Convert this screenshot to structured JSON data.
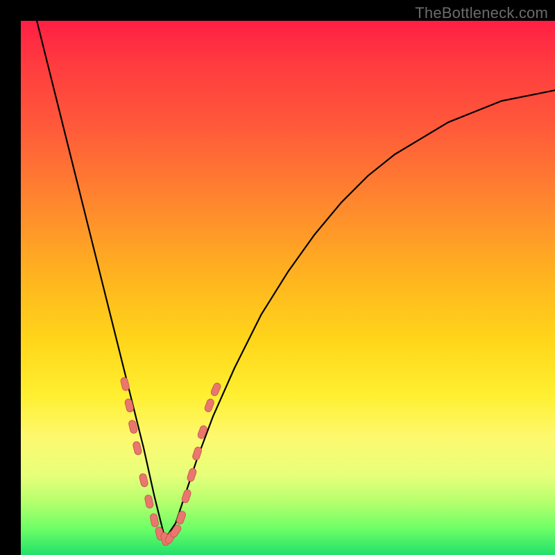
{
  "watermark": {
    "text": "TheBottleneck.com"
  },
  "colors": {
    "frame": "#000000",
    "curve_stroke": "#000000",
    "marker_fill": "#e9776e",
    "marker_stroke": "#c95a52"
  },
  "chart_data": {
    "type": "line",
    "title": "",
    "xlabel": "",
    "ylabel": "",
    "xlim": [
      0,
      100
    ],
    "ylim": [
      0,
      100
    ],
    "grid": false,
    "legend": false,
    "annotations": [],
    "series": [
      {
        "name": "curve",
        "comment": "V-shaped bottleneck curve; values estimated from pixel positions. y is percentage height from bottom (0) to top (100). Minimum near x≈27.",
        "x": [
          3,
          5,
          7,
          9,
          11,
          13,
          15,
          17,
          19,
          21,
          23,
          25,
          27,
          29,
          31,
          33,
          36,
          40,
          45,
          50,
          55,
          60,
          65,
          70,
          75,
          80,
          85,
          90,
          95,
          100
        ],
        "y": [
          100,
          92,
          84,
          76,
          68,
          60,
          52,
          44,
          36,
          28,
          20,
          11,
          3,
          6,
          12,
          18,
          26,
          35,
          45,
          53,
          60,
          66,
          71,
          75,
          78,
          81,
          83,
          85,
          86,
          87
        ]
      }
    ],
    "markers": {
      "comment": "Salmon capsule markers clustered on both arms of the V near its minimum.",
      "points_xy": [
        [
          19.5,
          32
        ],
        [
          20.3,
          28
        ],
        [
          21.0,
          24
        ],
        [
          21.8,
          20
        ],
        [
          23.0,
          14
        ],
        [
          24.0,
          10
        ],
        [
          25.0,
          6.5
        ],
        [
          26.0,
          4
        ],
        [
          27.0,
          3
        ],
        [
          28.0,
          3.3
        ],
        [
          29.0,
          4.5
        ],
        [
          30.0,
          7
        ],
        [
          31.0,
          11
        ],
        [
          32.0,
          15
        ],
        [
          33.0,
          19
        ],
        [
          34.0,
          23
        ],
        [
          35.3,
          28
        ],
        [
          36.5,
          31
        ]
      ]
    }
  }
}
